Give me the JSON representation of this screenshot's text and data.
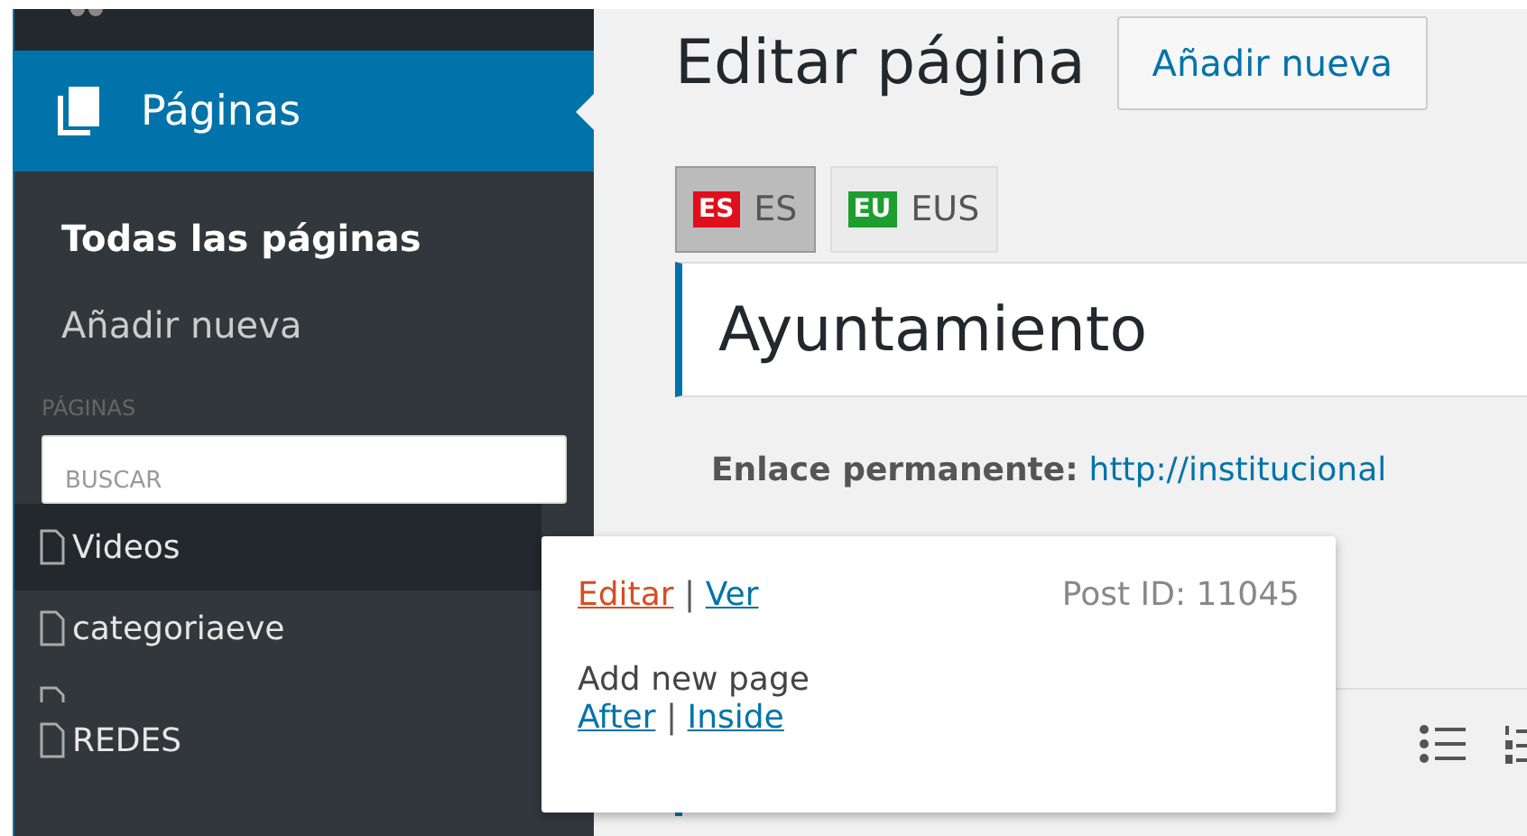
{
  "sidebar": {
    "menu": {
      "label": "Páginas",
      "selected": true
    },
    "submenu": [
      {
        "label": "Todas las páginas",
        "selected": true
      },
      {
        "label": "Añadir nueva",
        "selected": false
      }
    ],
    "section_label": "PÁGINAS",
    "search": {
      "placeholder": "BUSCAR"
    },
    "pages": [
      {
        "kind": "page",
        "label": "Videos",
        "selected": true
      },
      {
        "kind": "page",
        "label": "categoriaeve",
        "selected": false
      },
      {
        "kind": "hidden"
      },
      {
        "kind": "page",
        "label": "REDES",
        "selected": false
      }
    ]
  },
  "main": {
    "title": "Editar página",
    "add_button": "Añadir nueva",
    "languages": [
      {
        "flag": "ES",
        "label": "ES",
        "color": "#e0101a",
        "selected": true
      },
      {
        "flag": "EU",
        "label": "EUS",
        "color": "#1e9e2e",
        "selected": false
      }
    ],
    "page_title": "Ayuntamiento",
    "permalink_label": "Enlace permanente:",
    "permalink": "http://institucional"
  },
  "popup": {
    "edit": "Editar",
    "separator": "|",
    "view": "Ver",
    "post_id": "Post ID: 11045",
    "add_label": "Add new page",
    "after": "After",
    "separator_2": "|",
    "inside": "Inside"
  }
}
